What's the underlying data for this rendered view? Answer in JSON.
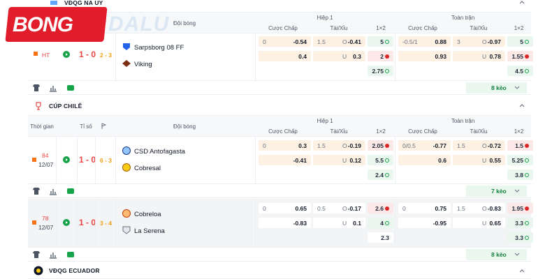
{
  "logo": {
    "text": "BONG",
    "watermark": "DALU"
  },
  "leagues": [
    {
      "name": "VĐQG NA UY"
    },
    {
      "name": "CÚP CHILÊ"
    },
    {
      "name": "VĐQG ECUADOR"
    }
  ],
  "headers": {
    "time": "Thời gian",
    "score": "Tỉ số",
    "team": "Đội bóng",
    "half": "Hiệp 1",
    "full": "Toàn trận",
    "handicap": "Cược Chấp",
    "ou": "Tài/Xỉu",
    "x12": "1×2"
  },
  "matches": [
    {
      "time_top": "HT",
      "time_bot": "",
      "score": "1 - 0",
      "corners": "2 - 3",
      "home": "Sarpsborg 08 FF",
      "away": "Viking",
      "rows": [
        {
          "h_a": "0",
          "h_v": "-0.54",
          "o_a": "1.5",
          "o_b": "O",
          "o_v": "-0.41",
          "x1": "5",
          "f_a": "-0.5/1",
          "f_v": "0.88",
          "fo_a": "3",
          "fo_b": "O",
          "fo_v": "-0.97",
          "x2": "5"
        },
        {
          "h_a": "",
          "h_v": "0.4",
          "o_a": "",
          "o_b": "U",
          "o_v": "0.3",
          "x1": "2",
          "f_a": "",
          "f_v": "0.93",
          "fo_a": "",
          "fo_b": "U",
          "fo_v": "0.78",
          "x2": "1.55"
        },
        {
          "x1": "2.75",
          "x2": "4.5"
        }
      ],
      "keo": "8 kèo"
    },
    {
      "time_top": "84",
      "time_bot": "12/07",
      "score": "1 - 0",
      "corners": "6 - 3",
      "home": "CSD Antofagasta",
      "away": "Cobresal",
      "rows": [
        {
          "h_a": "0",
          "h_v": "0.3",
          "o_a": "1.5",
          "o_b": "O",
          "o_v": "-0.19",
          "x1": "2.05",
          "f_a": "0/0.5",
          "f_v": "-0.77",
          "fo_a": "1.5",
          "fo_b": "O",
          "fo_v": "-0.72",
          "x2": "1.5"
        },
        {
          "h_a": "",
          "h_v": "-0.41",
          "o_a": "",
          "o_b": "U",
          "o_v": "0.12",
          "x1": "5.5",
          "f_a": "",
          "f_v": "0.6",
          "fo_a": "",
          "fo_b": "U",
          "fo_v": "0.55",
          "x2": "5.25"
        },
        {
          "x1": "2.4",
          "x2": "3.8"
        }
      ],
      "keo": "7 kèo"
    },
    {
      "time_top": "78",
      "time_bot": "12/07",
      "score": "1 - 0",
      "corners": "3 - 4",
      "home": "Cobreloa",
      "away": "La Serena",
      "rows": [
        {
          "h_a": "0",
          "h_v": "0.65",
          "o_a": "0.5",
          "o_b": "O",
          "o_v": "-0.17",
          "x1": "2.6",
          "f_a": "0",
          "f_v": "0.75",
          "fo_a": "1.5",
          "fo_b": "O",
          "fo_v": "-0.83",
          "x2": "1.95"
        },
        {
          "h_a": "",
          "h_v": "-0.83",
          "o_a": "",
          "o_b": "U",
          "o_v": "0.1",
          "x1": "4",
          "f_a": "",
          "f_v": "-0.95",
          "fo_a": "",
          "fo_b": "U",
          "fo_v": "0.65",
          "x2": "3.3"
        },
        {
          "x1": "2.3",
          "x2": "3.3"
        }
      ],
      "keo": "8 kèo"
    }
  ],
  "colors": {
    "accent_red": "#ef4444",
    "accent_green": "#16a34a",
    "brand_red": "#e11d2b"
  }
}
